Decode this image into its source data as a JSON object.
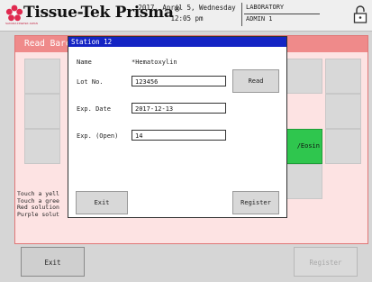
{
  "header": {
    "brand": "Tissue-Tek Prisma",
    "brand_mark": "®",
    "brand_tagline": "SAKURA FINETEK JAPAN",
    "date_line": "2017, April 5, Wednesday",
    "time_line": "12:05 pm",
    "location": "LABORATORY",
    "user": "ADMIN 1",
    "accent_color": "#e0294f"
  },
  "panel": {
    "title": "Read Barc",
    "green_label": "/Eosin",
    "notes": [
      "Touch a yell",
      "Touch a gree",
      "Red solution",
      "Purple solut"
    ],
    "header_color": "#ef8a8a",
    "background_color": "#fde3e3"
  },
  "dialog": {
    "title": "Station 12",
    "name_label": "Name",
    "name_value": "*Hematoxylin",
    "lot_label": "Lot No.",
    "lot_value": "123456",
    "read_button": "Read",
    "expdate_label": "Exp. Date",
    "expdate_value": "2017-12-13",
    "expopen_label": "Exp. (Open)",
    "expopen_value": "14",
    "exit_button": "Exit",
    "register_button": "Register",
    "title_bar_color": "#1424c4"
  },
  "footer": {
    "exit_button": "Exit",
    "register_button": "Register"
  }
}
